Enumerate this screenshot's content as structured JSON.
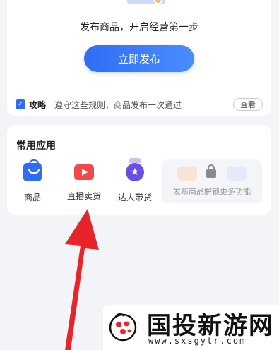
{
  "publish_card": {
    "hint": "发布商品，开启经营第一步",
    "publish_button": "立即发布",
    "tip_tag": "攻略",
    "tip_text": "遵守这些规则，商品发布一次通过",
    "view_button": "查看"
  },
  "apps": {
    "title": "常用应用",
    "items": [
      {
        "label": "商品",
        "icon": "shopping-bag-icon",
        "color": "#2f6df6"
      },
      {
        "label": "直播卖货",
        "icon": "live-video-icon",
        "color": "#f24a4a"
      },
      {
        "label": "达人带货",
        "icon": "star-medal-icon",
        "color": "#6b4fe0"
      }
    ],
    "locked_text": "发布商品解锁更多功能"
  },
  "watermark": {
    "title": "国投新游网",
    "url": "www.sxsgytr.com"
  },
  "colors": {
    "accent": "#2f6df6",
    "arrow": "#e8242b"
  }
}
